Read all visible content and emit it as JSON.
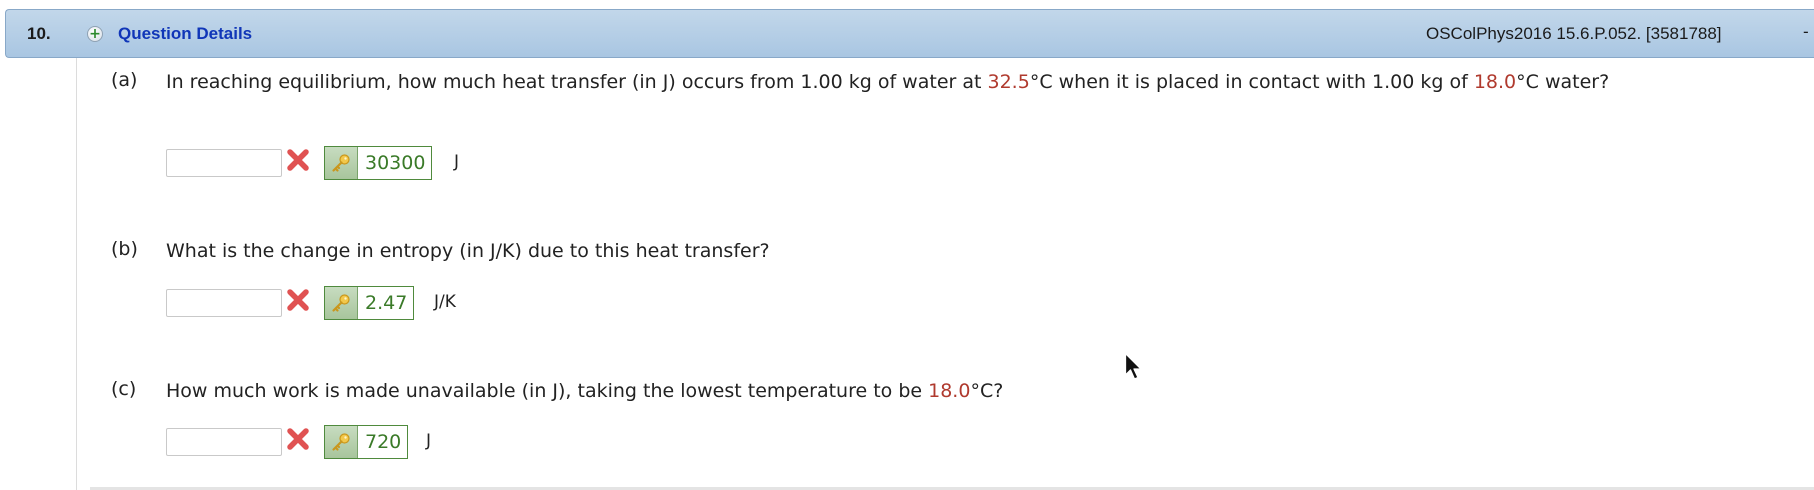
{
  "header": {
    "question_number": "10.",
    "details_label": "Question Details",
    "reference": "OSColPhys2016 15.6.P.052. [3581788]",
    "dash": "-"
  },
  "parts": [
    {
      "label": "(a)",
      "text": {
        "t1": "In reaching equilibrium, how much heat transfer (in J) occurs from 1.00 kg of water at ",
        "v1": "32.5",
        "t2": "°C when it is placed in contact with 1.00 kg of ",
        "v2": "18.0",
        "t3": "°C water?"
      },
      "input_value": "",
      "answer_key": "30300",
      "unit": "J"
    },
    {
      "label": "(b)",
      "text": {
        "t1": "What is the change in entropy (in J/K) due to this heat transfer?"
      },
      "input_value": "",
      "answer_key": "2.47",
      "unit": "J/K"
    },
    {
      "label": "(c)",
      "text": {
        "t1": "How much work is made unavailable (in J), taking the lowest temperature to be ",
        "v1": "18.0",
        "t2": "°C?"
      },
      "input_value": "",
      "answer_key": "720",
      "unit": "J"
    }
  ],
  "icons": {
    "expand": "plus-circle-icon",
    "incorrect": "red-x-icon",
    "answer_key": "key-icon",
    "pointer": "mouse-cursor-icon"
  },
  "colors": {
    "header_bg": "#a9c6e2",
    "link_blue": "#1036b8",
    "given_value_red": "#b03a2e",
    "answer_green": "#3a7a28",
    "incorrect_red": "#e05252"
  }
}
